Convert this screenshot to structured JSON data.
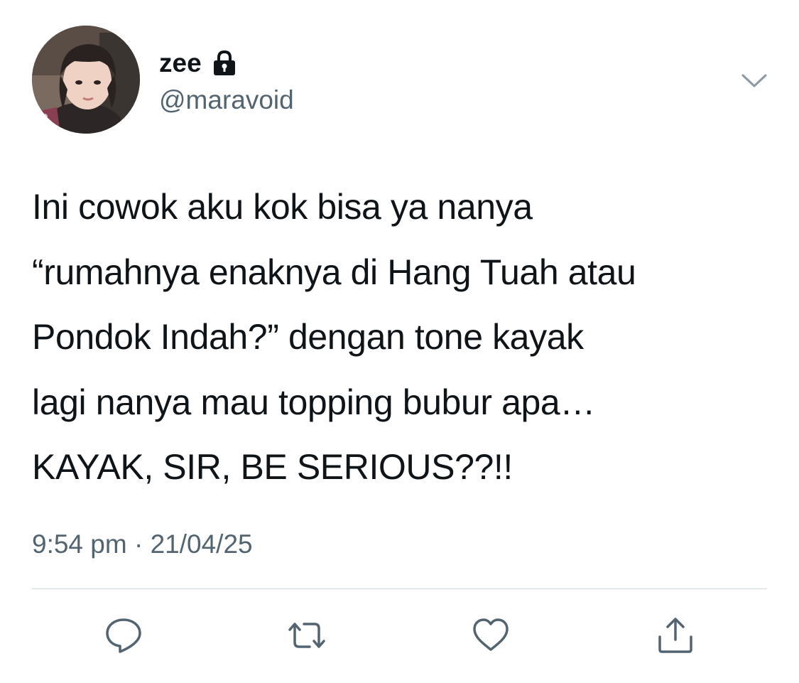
{
  "user": {
    "display_name": "zee",
    "handle": "@maravoid",
    "protected": true,
    "avatar_icon": "profile-photo"
  },
  "tweet": {
    "text": "Ini cowok aku kok bisa ya nanya\n“rumahnya enaknya di Hang Tuah atau\nPondok Indah?” dengan tone kayak\nlagi nanya mau topping bubur apa…\nKAYAK, SIR, BE SERIOUS??!!",
    "timestamp": "9:54 pm · 21/04/25"
  },
  "actions": {
    "reply_icon": "reply-icon",
    "retweet_icon": "retweet-icon",
    "like_icon": "heart-icon",
    "share_icon": "share-icon"
  },
  "colors": {
    "text_primary": "#0f1419",
    "text_secondary": "#536471",
    "divider": "#cfd9de",
    "background": "#ffffff"
  }
}
